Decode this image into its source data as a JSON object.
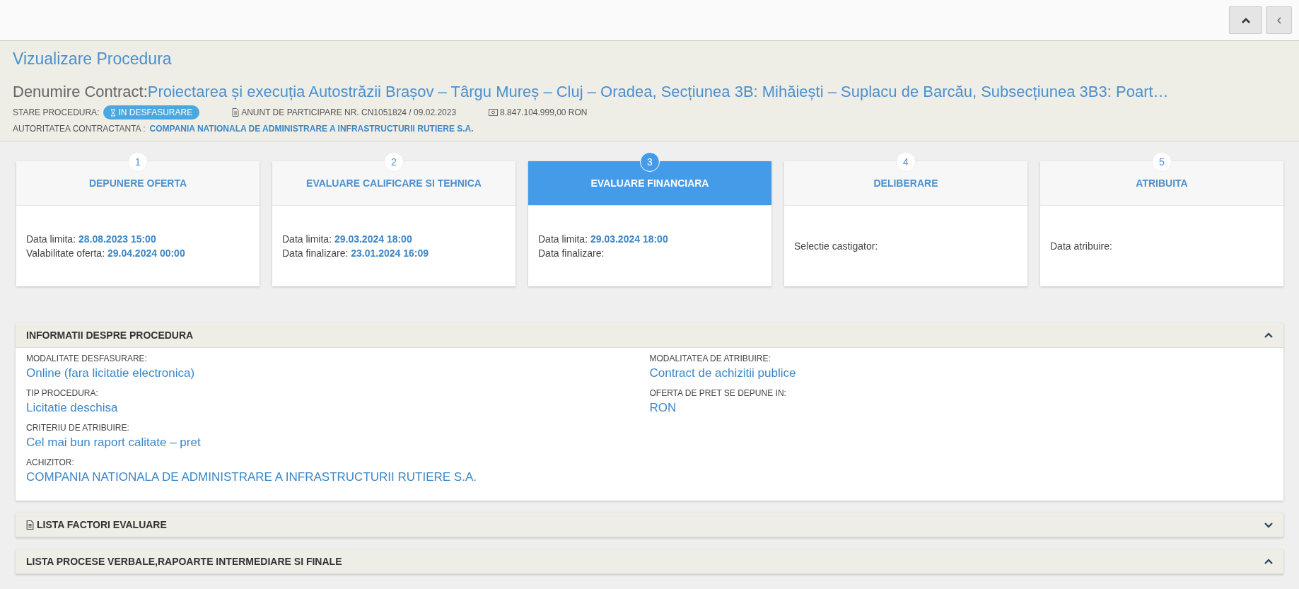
{
  "header": {
    "title": "Vizualizare Procedura",
    "contract_label": "Denumire Contract:",
    "contract_name": "Proiectarea și execuția Autostrăzii Brașov – Târgu Mureș – Cluj – Oradea, Secțiunea 3B: Mihăiești – Suplacu de Barcău, Subsecțiunea 3B3: Poart…",
    "status_label": "STARE PROCEDURA:",
    "status_badge": "IN DESFASURARE",
    "notice": "ANUNT DE PARTICIPARE NR. CN1051824 / 09.02.2023",
    "amount": "8.847.104.999,00  RON",
    "authority_label": "AUTORITATEA CONTRACTANTA :",
    "authority": "COMPANIA NATIONALA DE ADMINISTRARE A INFRASTRUCTURII RUTIERE S.A."
  },
  "stages": [
    {
      "number": "1",
      "title": "DEPUNERE OFERTA",
      "selected": false,
      "lines": [
        {
          "label": "Data limita:",
          "value": "28.08.2023 15:00"
        },
        {
          "label": "Valabilitate oferta:",
          "value": "29.04.2024 00:00"
        }
      ]
    },
    {
      "number": "2",
      "title": "EVALUARE CALIFICARE SI TEHNICA",
      "selected": false,
      "lines": [
        {
          "label": "Data limita:",
          "value": "29.03.2024 18:00"
        },
        {
          "label": "Data finalizare:",
          "value": "23.01.2024 16:09"
        }
      ]
    },
    {
      "number": "3",
      "title": "EVALUARE FINANCIARA",
      "selected": true,
      "lines": [
        {
          "label": "Data limita:",
          "value": "29.03.2024 18:00"
        },
        {
          "label": "Data finalizare:"
        }
      ]
    },
    {
      "number": "4",
      "title": "DELIBERARE",
      "selected": false,
      "lines": [
        {
          "label": "Selectie castigator:"
        }
      ]
    },
    {
      "number": "5",
      "title": "ATRIBUITA",
      "selected": false,
      "lines": [
        {
          "label": "Data atribuire:"
        }
      ]
    }
  ],
  "sections": [
    {
      "title": "INFORMATII DESPRE PROCEDURA",
      "kind": "plain",
      "expanded": true,
      "columns": [
        [
          {
            "label": "MODALITATE DESFASURARE:",
            "value": "Online (fara licitatie electronica)"
          },
          {
            "label": "TIP PROCEDURA:",
            "value": "Licitatie deschisa"
          },
          {
            "label": "CRITERIU DE ATRIBUIRE:",
            "value": "Cel mai bun raport calitate – pret"
          },
          {
            "label": "ACHIZITOR:",
            "value": "COMPANIA NATIONALA DE ADMINISTRARE A INFRASTRUCTURII RUTIERE S.A."
          }
        ],
        [
          {
            "label": "MODALITATEA DE ATRIBUIRE:",
            "value": "Contract de achizitii publice"
          },
          {
            "label": "OFERTA DE PRET SE DEPUNE IN:",
            "value": "RON"
          }
        ]
      ]
    },
    {
      "title": "LISTA FACTORI EVALUARE",
      "kind": "document",
      "expanded": false
    },
    {
      "title": "LISTA PROCESE VERBALE,RAPOARTE INTERMEDIARE SI FINALE",
      "kind": "plain",
      "expanded": true
    }
  ]
}
